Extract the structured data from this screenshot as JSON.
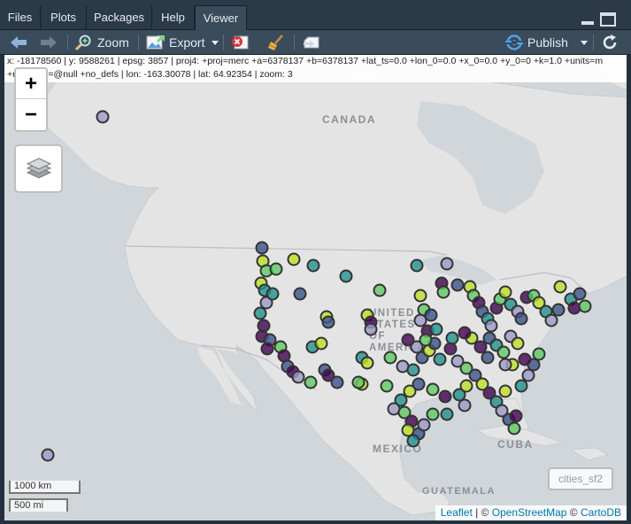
{
  "tabs": [
    {
      "label": "Files",
      "active": false
    },
    {
      "label": "Plots",
      "active": false
    },
    {
      "label": "Packages",
      "active": false
    },
    {
      "label": "Help",
      "active": false
    },
    {
      "label": "Viewer",
      "active": true
    }
  ],
  "toolbar": {
    "zoom_label": "Zoom",
    "export_label": "Export",
    "publish_label": "Publish"
  },
  "map": {
    "coordinates_line1": "x: -18178560 | y: 9588261 | epsg: 3857 | proj4: +proj=merc +a=6378137 +b=6378137 +lat_ts=0.0 +lon_0=0.0 +x_0=0.0 +y_0=0 +k=1.0 +units=m",
    "coordinates_line2": "+nadgrids=@null +no_defs | lon: -163.30078 | lat: 64.92354 | zoom: 3",
    "zoom_in": "+",
    "zoom_out": "−",
    "scale_km": "1000 km",
    "scale_mi": "500 mi",
    "layer_name": "cities_sf2",
    "places": {
      "canada": "CANADA",
      "united_states": "UNITED STATES OF AMERICA",
      "mexico": "MEXICO",
      "cuba": "CUBA",
      "guatemala": "GUATEMALA"
    },
    "attribution": {
      "leaflet": "Leaflet",
      "sep1": " | © ",
      "osm": "OpenStreetMap",
      "sep2": " © ",
      "carto": "CartoDB"
    },
    "colors": {
      "land": "#e4e4e4",
      "water": "#d1d6da",
      "marker_border": "#333333",
      "viridis": [
        "#440154",
        "#3b528b",
        "#21918c",
        "#5ec962",
        "#bddf26",
        "#9e9ac8"
      ]
    }
  }
}
